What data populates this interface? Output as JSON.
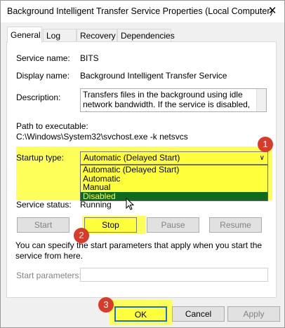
{
  "window": {
    "title": "Background Intelligent Transfer Service Properties (Local Computer)",
    "close_glyph": "✕"
  },
  "tabs": [
    "General",
    "Log On",
    "Recovery",
    "Dependencies"
  ],
  "general": {
    "service_name_label": "Service name:",
    "service_name_value": "BITS",
    "display_name_label": "Display name:",
    "display_name_value": "Background Intelligent Transfer Service",
    "description_label": "Description:",
    "description_value": "Transfers files in the background using idle network bandwidth. If the service is disabled, then any",
    "path_label": "Path to executable:",
    "path_value": "C:\\Windows\\System32\\svchost.exe -k netsvcs",
    "startup_type_label": "Startup type:",
    "startup_type_value": "Automatic (Delayed Start)",
    "startup_options": [
      "Automatic (Delayed Start)",
      "Automatic",
      "Manual",
      "Disabled"
    ],
    "highlighted_option": "Disabled",
    "service_status_label": "Service status:",
    "service_status_value": "Running"
  },
  "control_buttons": {
    "start": "Start",
    "stop": "Stop",
    "pause": "Pause",
    "resume": "Resume"
  },
  "note": "You can specify the start parameters that apply when you start the service from here.",
  "start_parameters_label": "Start parameters:",
  "start_parameters_value": "",
  "footer_buttons": {
    "ok": "OK",
    "cancel": "Cancel",
    "apply": "Apply"
  },
  "badges": [
    "1",
    "2",
    "3"
  ],
  "colors": {
    "highlight": "#ffff5a",
    "badge": "#d93a2a",
    "selected_option_bg": "#0e6a1c"
  }
}
